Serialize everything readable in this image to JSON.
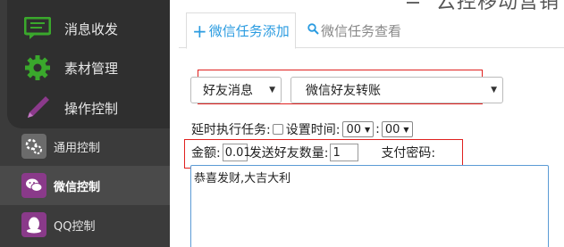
{
  "sidebar": {
    "top_items": [
      {
        "label": "消息收发",
        "icon": "chat-bubble-icon"
      },
      {
        "label": "素材管理",
        "icon": "gear-icon"
      },
      {
        "label": "操作控制",
        "icon": "pen-icon"
      }
    ],
    "sub_items": [
      {
        "label": "通用控制",
        "icon": "gears-icon"
      },
      {
        "label": "微信控制",
        "icon": "wechat-icon"
      },
      {
        "label": "QQ控制",
        "icon": "qq-penguin-icon"
      }
    ]
  },
  "header": {
    "banner_text": "云控移动营销"
  },
  "tabs": {
    "add_label": "微信任务添加",
    "view_label": "微信任务查看"
  },
  "form": {
    "type_select": "好友消息",
    "task_select": "微信好友转账",
    "delay_label": "延时执行任务:",
    "set_time_label": "设置时间:",
    "hour_value": "00",
    "minute_value": "00",
    "time_separator": ":",
    "amount_label": "金额:",
    "amount_value": "0.01",
    "friend_count_label": "发送好友数量:",
    "friend_count_value": "1",
    "pay_password_label": "支付密码:",
    "message_text": "恭喜发财,大吉大利"
  },
  "colors": {
    "accent_blue": "#2a9be0",
    "highlight_red": "#e0211f",
    "sidebar_bg": "#3b3b3b",
    "icon_green": "#3aa82c"
  }
}
